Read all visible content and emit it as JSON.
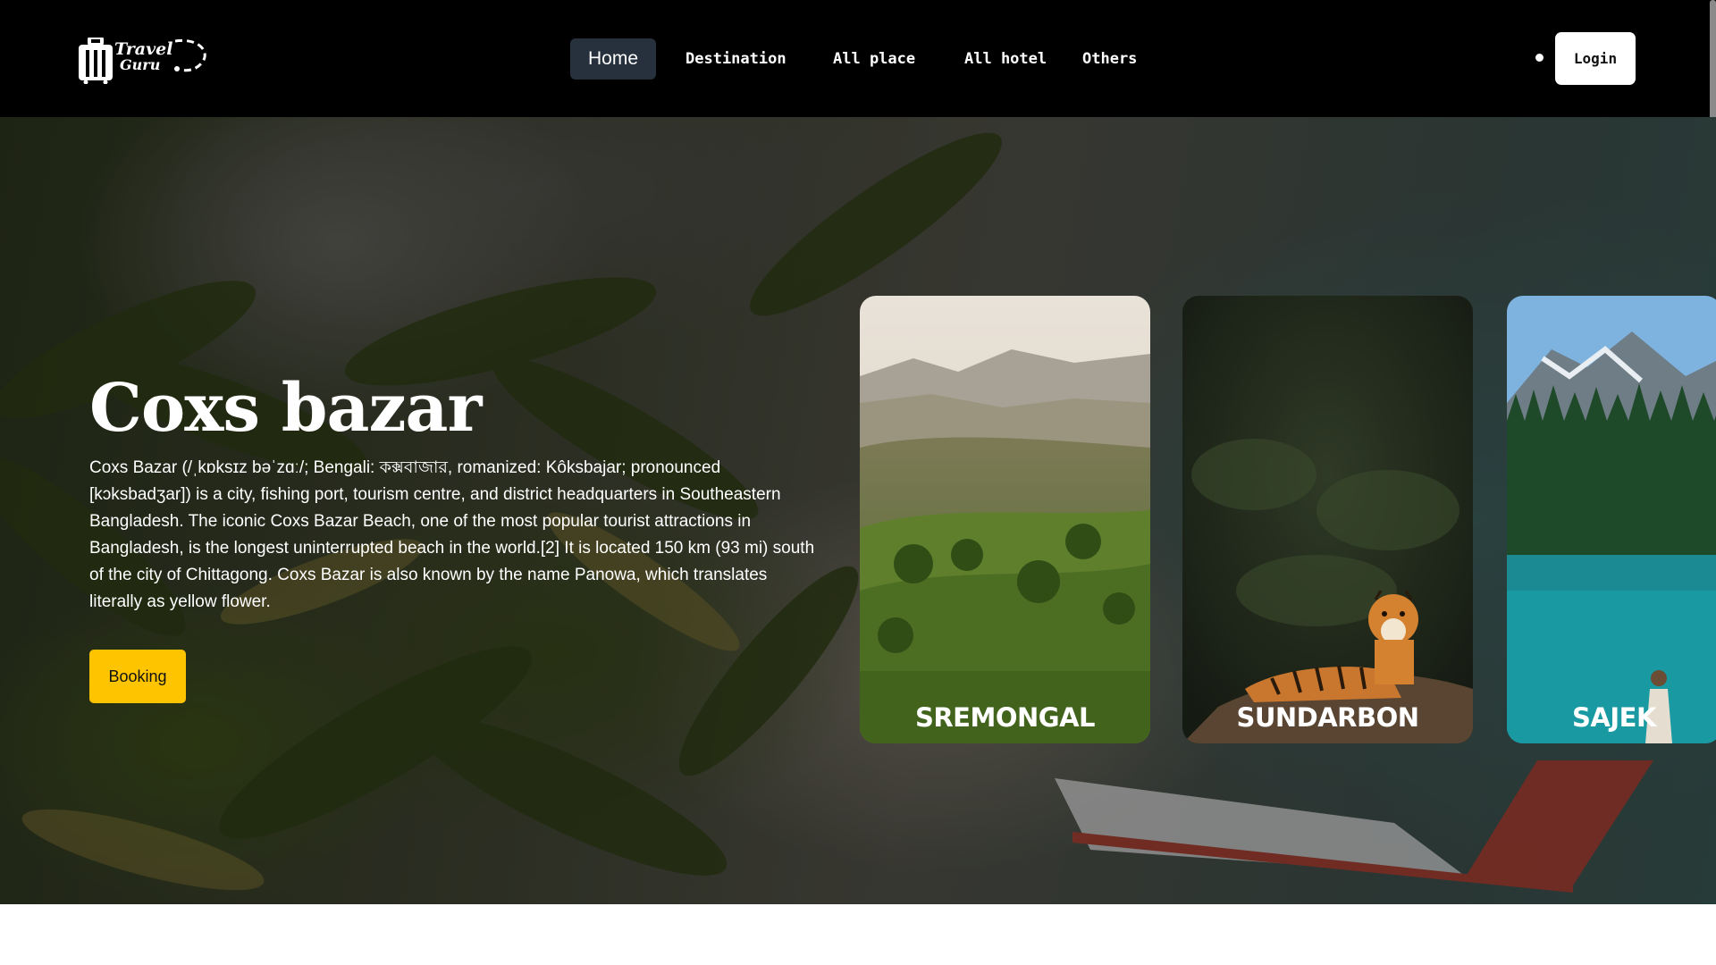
{
  "brand": {
    "logo_line1": "Travel",
    "logo_line2": "Guru"
  },
  "nav": {
    "items": [
      {
        "label": "Home",
        "active": true
      },
      {
        "label": "Destination",
        "active": false
      },
      {
        "label": "All place",
        "active": false
      },
      {
        "label": "All hotel",
        "active": false
      },
      {
        "label": "Others",
        "active": false
      }
    ],
    "login_label": "Login"
  },
  "hero": {
    "title": "Coxs bazar",
    "description": "Coxs Bazar (/ˌkɒksɪz bəˈzɑː/; Bengali: কক্সবাজার, romanized: Kôksbajar; pronounced [kɔksbadʒar]) is a city, fishing port, tourism centre, and district headquarters in Southeastern Bangladesh. The iconic Coxs Bazar Beach, one of the most popular tourist attractions in Bangladesh, is the longest uninterrupted beach in the world.[2] It is located 150 km (93 mi) south of the city of Chittagong. Coxs Bazar is also known by the name Panowa, which translates literally as yellow flower.",
    "booking_label": "Booking"
  },
  "cards": [
    {
      "label": "SREMONGAL"
    },
    {
      "label": "SUNDARBON"
    },
    {
      "label": "SAJEK"
    }
  ],
  "colors": {
    "navbar_bg": "#000000",
    "nav_active_bg": "#27303d",
    "booking_bg": "#ffc400",
    "login_bg": "#ffffff"
  }
}
